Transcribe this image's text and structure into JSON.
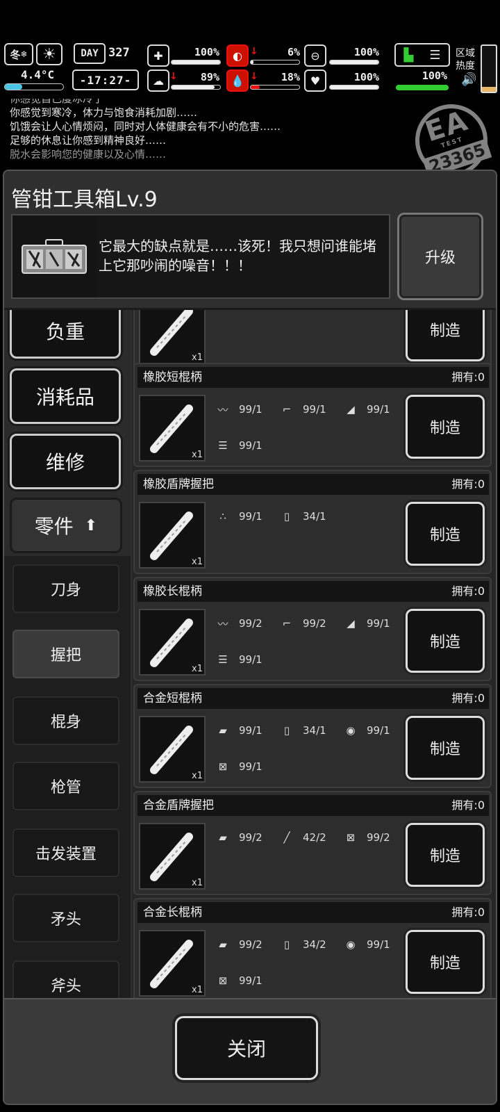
{
  "hud": {
    "season": "冬",
    "season_icon": "snow-icon",
    "weather_icon": "sun-icon",
    "temperature": "4.4°C",
    "day_label": "DAY",
    "day_number": "327",
    "time": "-17:27-",
    "stats": [
      {
        "name": "health",
        "icon": "medkit-icon",
        "value": "100%",
        "level": 1.0,
        "down": false
      },
      {
        "name": "hunger",
        "icon": "stomach-icon",
        "value": "6%",
        "level": 0.06,
        "down": true
      },
      {
        "name": "stamina",
        "icon": "lungs-icon",
        "value": "100%",
        "level": 1.0,
        "down": false
      },
      {
        "name": "mood",
        "icon": "brain-icon",
        "value": "89%",
        "level": 0.89,
        "down": true
      },
      {
        "name": "thirst",
        "icon": "water-drop-icon",
        "value": "18%",
        "level": 0.18,
        "down": true
      },
      {
        "name": "heart",
        "icon": "heart-icon",
        "value": "100%",
        "level": 1.0,
        "down": false
      }
    ],
    "cold_value": "100%",
    "region_label_1": "区域",
    "region_label_2": "热度",
    "region_level": 0.1
  },
  "log": {
    "partial_top": "你感觉自己度冰冷了",
    "lines": [
      "你感觉到寒冷，体力与饱食消耗加剧……",
      "饥饿会让人心情烦闷，同时对人体健康会有不小的危害……",
      "足够的休息让你感到精神良好……"
    ],
    "dim_line": "脱水会影响您的健康以及心情……"
  },
  "stamp": {
    "big": "EA",
    "small": "TEST",
    "number": "23365"
  },
  "header": {
    "title": "管钳工具箱Lv.9",
    "description": "它最大的缺点就是……该死！我只想问谁能堵上它那吵闹的噪音！！！",
    "upgrade_label": "升级"
  },
  "sidebar": {
    "categories": [
      {
        "label": "负重"
      },
      {
        "label": "消耗品"
      },
      {
        "label": "维修"
      },
      {
        "label": "零件"
      }
    ],
    "subcategories": [
      {
        "label": "刀身"
      },
      {
        "label": "握把"
      },
      {
        "label": "棍身"
      },
      {
        "label": "枪管"
      },
      {
        "label": "击发装置"
      },
      {
        "label": "矛头"
      },
      {
        "label": "斧头"
      }
    ]
  },
  "recipes": [
    {
      "name": "",
      "own": "",
      "qty": "x1",
      "make_label": "制造",
      "materials": []
    },
    {
      "name": "橡胶短棍柄",
      "own": "拥有:0",
      "qty": "x1",
      "make_label": "制造",
      "materials": [
        {
          "icon": "rubber-strip-icon",
          "amount": "99/1"
        },
        {
          "icon": "pipe-fitting-icon",
          "amount": "99/1"
        },
        {
          "icon": "cloth-icon",
          "amount": "99/1"
        },
        {
          "icon": "wood-logs-icon",
          "amount": "99/1"
        }
      ]
    },
    {
      "name": "橡胶盾牌握把",
      "own": "拥有:0",
      "qty": "x1",
      "make_label": "制造",
      "materials": [
        {
          "icon": "granules-icon",
          "amount": "99/1"
        },
        {
          "icon": "jerrycan-icon",
          "amount": "34/1"
        }
      ]
    },
    {
      "name": "橡胶长棍柄",
      "own": "拥有:0",
      "qty": "x1",
      "make_label": "制造",
      "materials": [
        {
          "icon": "rubber-strip-icon",
          "amount": "99/2"
        },
        {
          "icon": "pipe-fitting-icon",
          "amount": "99/2"
        },
        {
          "icon": "cloth-icon",
          "amount": "99/1"
        },
        {
          "icon": "wood-logs-icon",
          "amount": "99/1"
        }
      ]
    },
    {
      "name": "合金短棍柄",
      "own": "拥有:0",
      "qty": "x1",
      "make_label": "制造",
      "materials": [
        {
          "icon": "metal-ingot-icon",
          "amount": "99/1"
        },
        {
          "icon": "jerrycan-icon",
          "amount": "34/1"
        },
        {
          "icon": "metal-sheet-roll-icon",
          "amount": "99/1"
        },
        {
          "icon": "battery-box-icon",
          "amount": "99/1"
        }
      ]
    },
    {
      "name": "合金盾牌握把",
      "own": "拥有:0",
      "qty": "x1",
      "make_label": "制造",
      "materials": [
        {
          "icon": "metal-ingot-icon",
          "amount": "99/2"
        },
        {
          "icon": "glue-tube-icon",
          "amount": "42/2"
        },
        {
          "icon": "battery-box-icon",
          "amount": "99/2"
        }
      ]
    },
    {
      "name": "合金长棍柄",
      "own": "拥有:0",
      "qty": "x1",
      "make_label": "制造",
      "materials": [
        {
          "icon": "metal-ingot-icon",
          "amount": "99/2"
        },
        {
          "icon": "jerrycan-icon",
          "amount": "34/2"
        },
        {
          "icon": "metal-sheet-roll-icon",
          "amount": "99/1"
        },
        {
          "icon": "battery-box-icon",
          "amount": "99/1"
        }
      ]
    }
  ],
  "footer": {
    "close_label": "关闭"
  }
}
